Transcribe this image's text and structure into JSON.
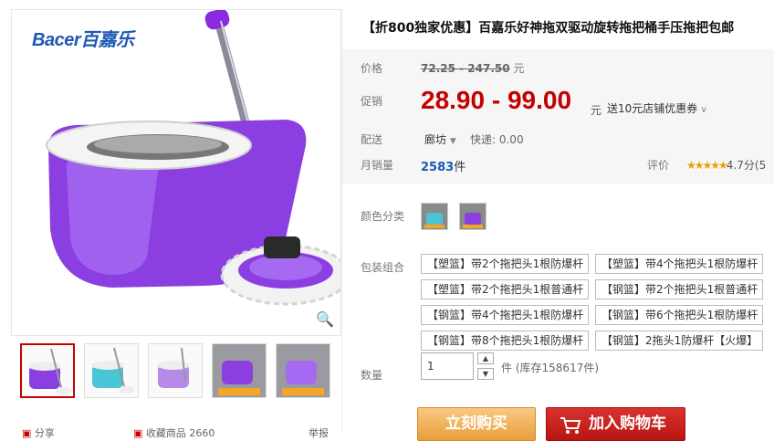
{
  "gallery": {
    "brand": "Bacer百嘉乐",
    "zoom_icon": "magnifier-icon",
    "thumbs": [
      "thumb-purple-mop",
      "thumb-teal-mop",
      "thumb-purple-mop-2",
      "thumb-promo-purple",
      "thumb-promo-purple-2"
    ],
    "bottom": {
      "share": "分享",
      "favorite": "收藏商品",
      "favorite_count": "2660",
      "report": "举报"
    }
  },
  "product": {
    "title": "【折800独家优惠】百嘉乐好神拖双驱动旋转拖把桶手压拖把包邮",
    "price_label": "价格",
    "price_range": "72.25 - 247.50",
    "currency_unit": "元",
    "promo_label": "促销",
    "promo_price": "28.90 - 99.00",
    "promo_unit": "元",
    "coupon": "送10元店铺优惠券",
    "ship_label": "配送",
    "ship_from": "廊坊",
    "express": "快递: 0.00",
    "sales_label": "月销量",
    "sales_count": "2583",
    "sales_unit": "件",
    "rating_label": "评价",
    "rating_stars": "★★★★★",
    "rating_value": "4.7分(5"
  },
  "options": {
    "color_label": "颜色分类",
    "package_label": "包装组合",
    "packages": [
      "【塑篮】带2个拖把头1根防爆杆",
      "【塑篮】带4个拖把头1根防爆杆",
      "【塑篮】带2个拖把头1根普通杆",
      "【钢篮】带2个拖把头1根普通杆",
      "【钢篮】带4个拖把头1根防爆杆",
      "【钢篮】带6个拖把头1根防爆杆",
      "【钢篮】带8个拖把头1根防爆杆",
      "【钢篮】2拖头1防爆杆【火爆】"
    ]
  },
  "purchase": {
    "qty_label": "数量",
    "qty_value": "1",
    "qty_unit": "件",
    "stock": "(库存158617件)",
    "buy_now": "立刻购买",
    "add_cart": "加入购物车"
  },
  "colors": {
    "accent_red": "#c40000",
    "link_blue": "#1e59b4",
    "buy_orange": "#f0b25c"
  }
}
